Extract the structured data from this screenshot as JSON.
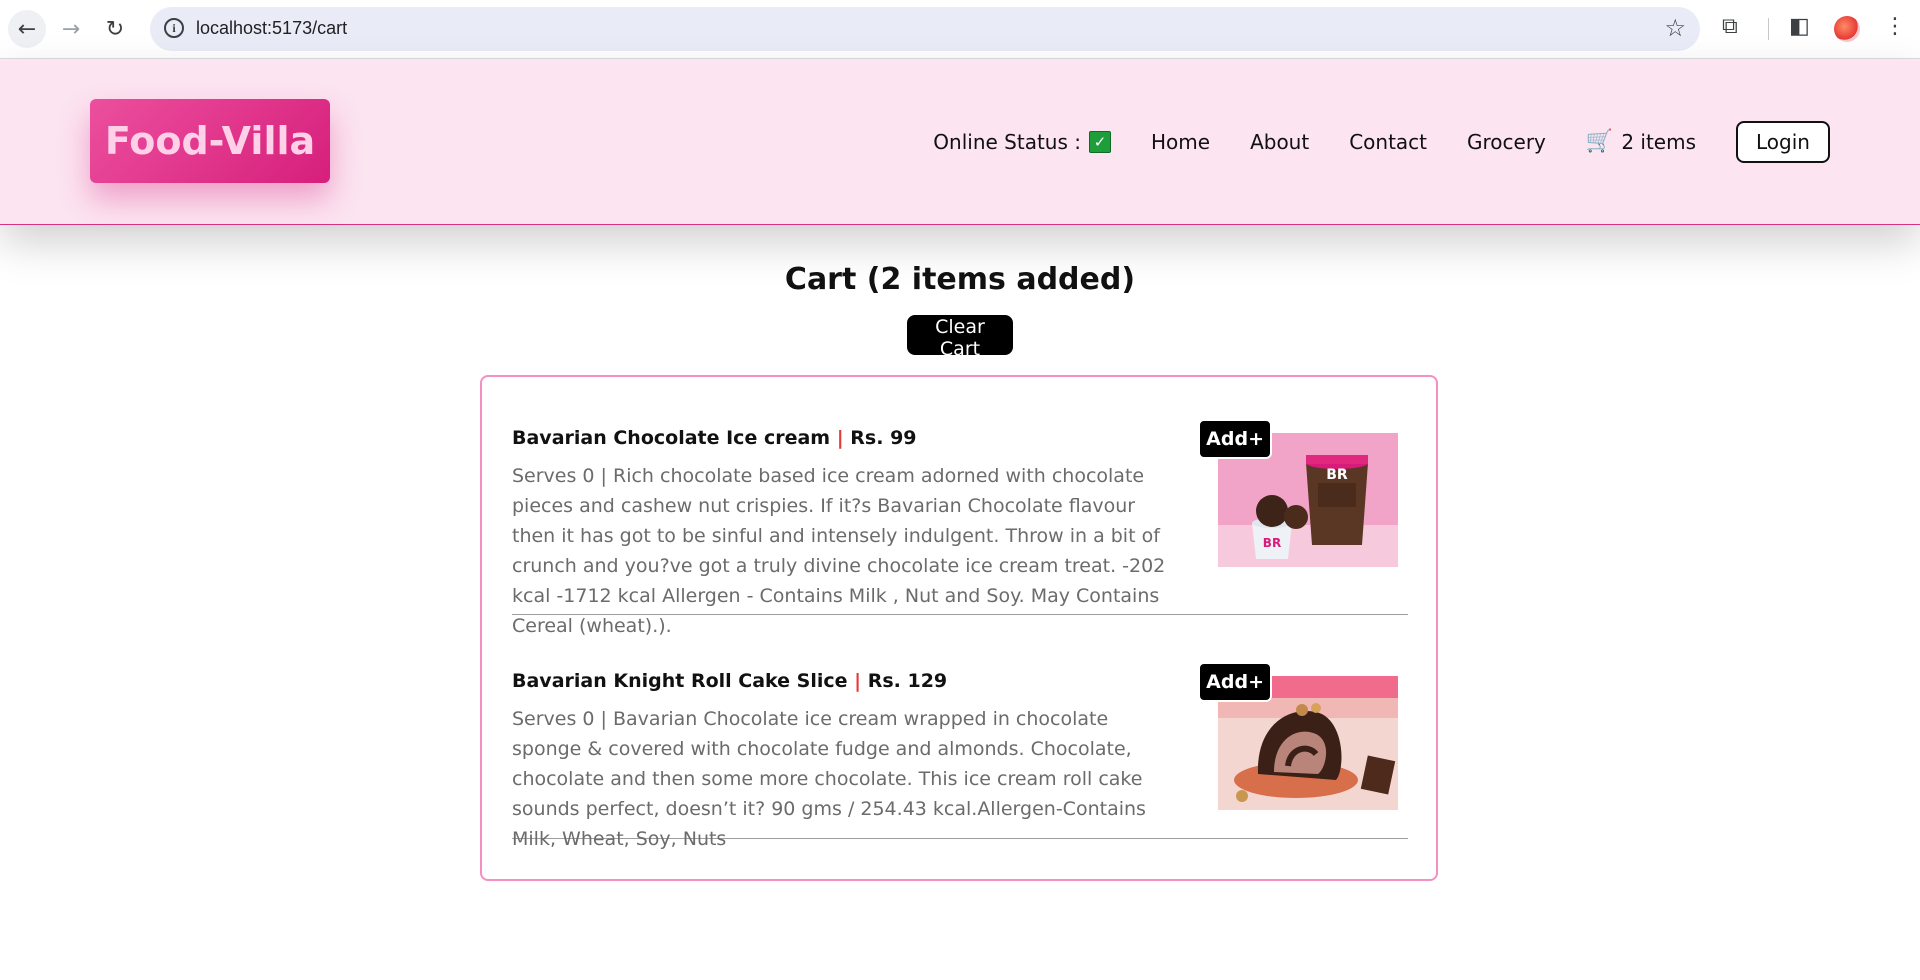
{
  "browser": {
    "url": "localhost:5173/cart"
  },
  "header": {
    "logo": "Food-Villa",
    "online_status_label": "Online Status :",
    "online_status_icon": "check-mark",
    "nav": [
      "Home",
      "About",
      "Contact",
      "Grocery"
    ],
    "cart_label": "2 items",
    "login_label": "Login"
  },
  "cart": {
    "title": "Cart (2 items added)",
    "clear_label": "Clear Cart",
    "items": [
      {
        "name": "Bavarian Chocolate Ice cream",
        "separator": "|",
        "price": "Rs. 99",
        "description": "Serves 0 | Rich chocolate based ice cream adorned with chocolate pieces and cashew nut crispies. If it?s Bavarian Chocolate flavour then it has got to be sinful and intensely indulgent. Throw in a bit of crunch and you?ve got a truly divine chocolate ice cream treat. -202 kcal -1712 kcal Allergen - Contains Milk , Nut and Soy. May Contains Cereal (wheat).).",
        "add_label": "Add+",
        "logo_text": "BR"
      },
      {
        "name": "Bavarian Knight Roll Cake Slice",
        "separator": "|",
        "price": "Rs. 129",
        "description": "Serves 0 | Bavarian Chocolate ice cream wrapped in chocolate sponge & covered with chocolate fudge and almonds. Chocolate, chocolate and then some more chocolate. This ice cream roll cake sounds perfect, doesn’t it? 90 gms / 254.43 kcal.Allergen-Contains Milk, Wheat, Soy, Nuts",
        "add_label": "Add+"
      }
    ]
  },
  "colors": {
    "header_bg": "#fce4f1",
    "brand": "#d61f7b",
    "price_separator": "#e53935"
  }
}
